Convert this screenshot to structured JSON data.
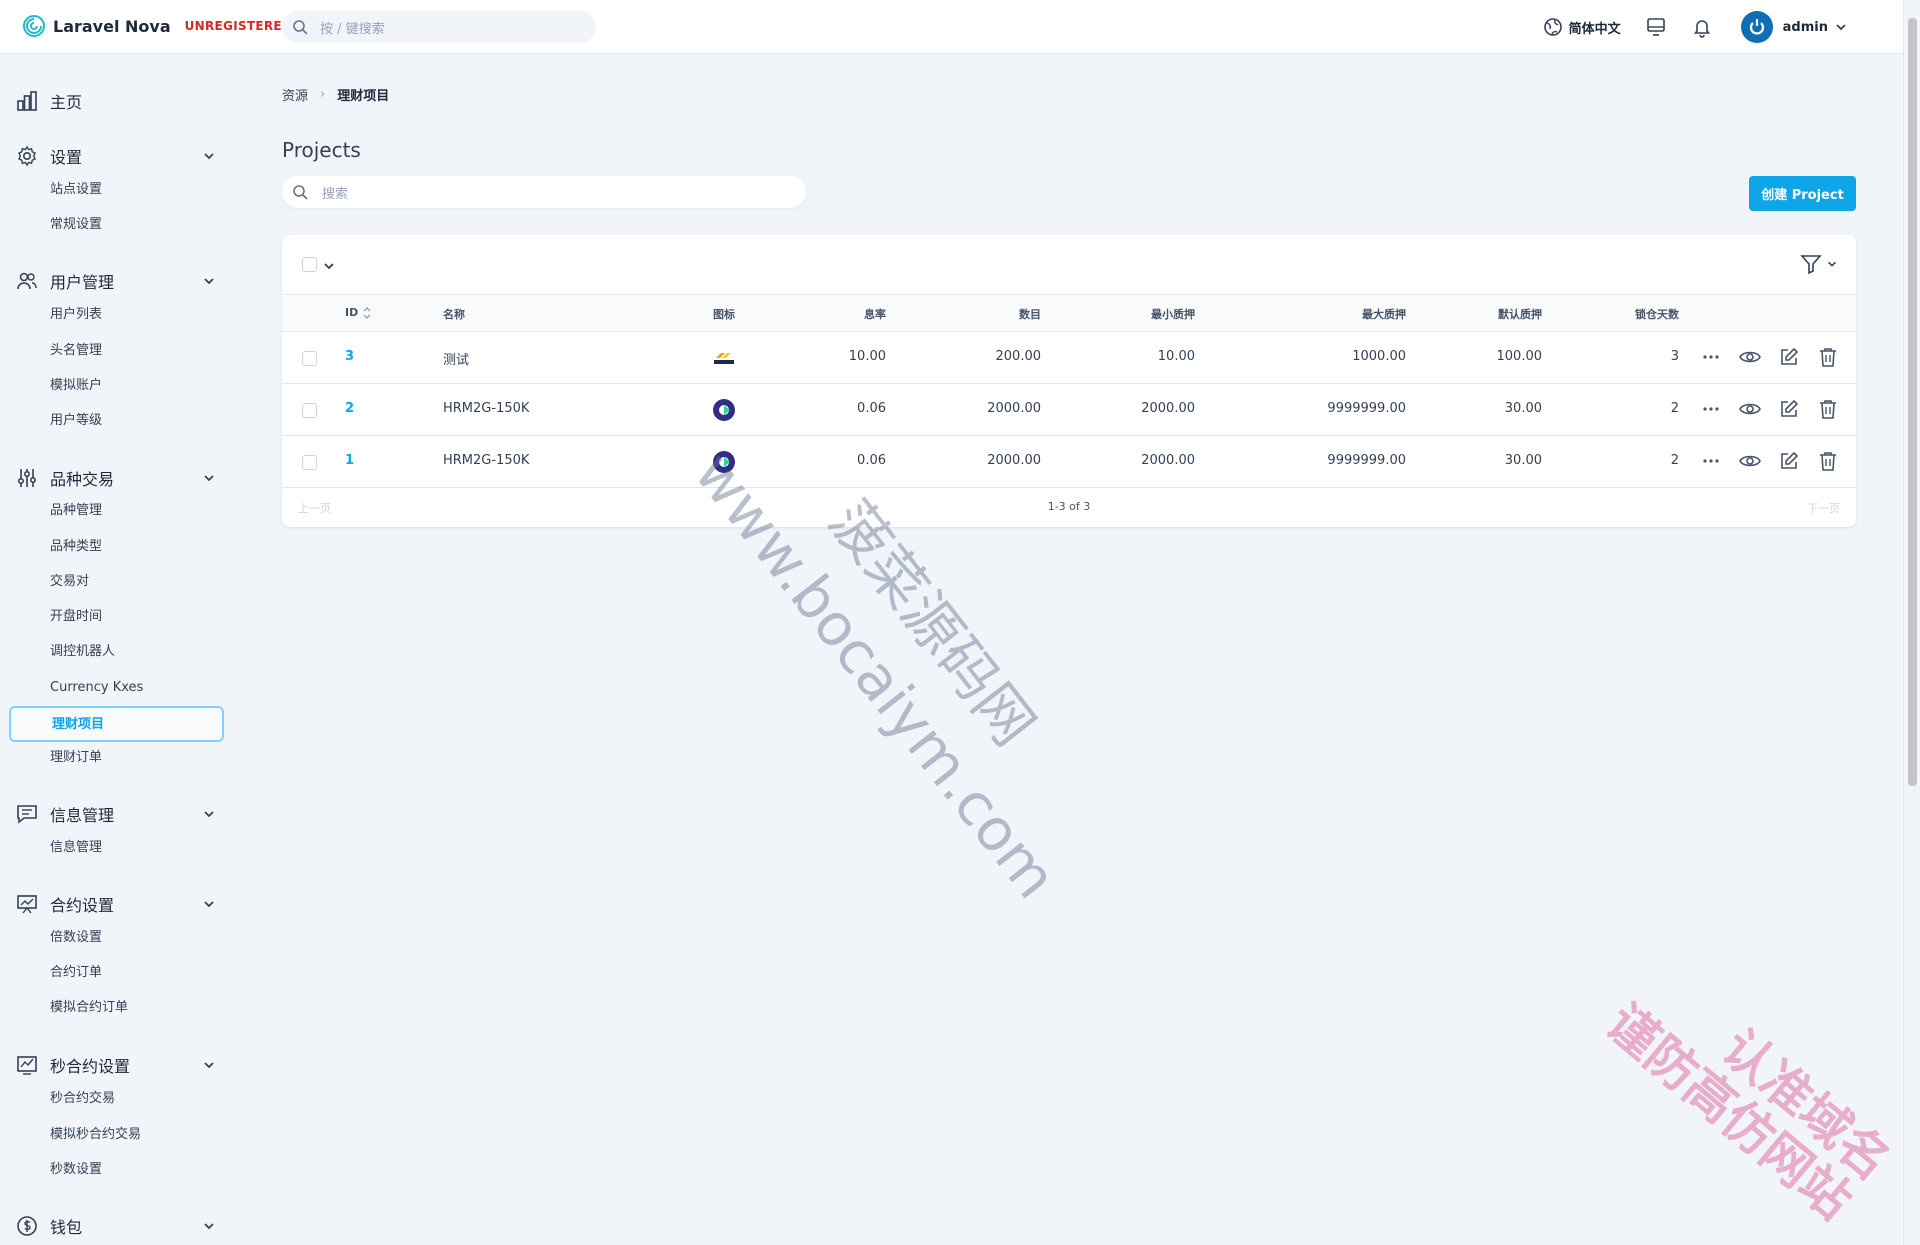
{
  "header": {
    "app_name": "Laravel Nova",
    "badge": "UNREGISTERED",
    "search_placeholder": "按 / 键搜索",
    "language": "简体中文",
    "user_name": "admin"
  },
  "sidebar": {
    "home": "主页",
    "groups": [
      {
        "label": "设置",
        "items": [
          "站点设置",
          "常规设置"
        ]
      },
      {
        "label": "用户管理",
        "items": [
          "用户列表",
          "头名管理",
          "模拟账户",
          "用户等级"
        ]
      },
      {
        "label": "品种交易",
        "items": [
          "品种管理",
          "品种类型",
          "交易对",
          "开盘时间",
          "调控机器人",
          "Currency Kxes",
          "理财项目",
          "理财订单"
        ]
      },
      {
        "label": "信息管理",
        "items": [
          "信息管理"
        ]
      },
      {
        "label": "合约设置",
        "items": [
          "倍数设置",
          "合约订单",
          "模拟合约订单"
        ]
      },
      {
        "label": "秒合约设置",
        "items": [
          "秒合约交易",
          "模拟秒合约交易",
          "秒数设置"
        ]
      },
      {
        "label": "钱包",
        "items": []
      }
    ],
    "active_item": "理财项目"
  },
  "breadcrumb": [
    "资源",
    "理财项目"
  ],
  "page_title": "Projects",
  "resource_search_placeholder": "搜索",
  "create_button": "创建 Project",
  "table": {
    "columns": [
      "ID",
      "名称",
      "图标",
      "息率",
      "数目",
      "最小质押",
      "最大质押",
      "默认质押",
      "锁仓天数"
    ],
    "rows": [
      {
        "id": "3",
        "name": "测试",
        "icon": "express-logo-icon",
        "rate": "10.00",
        "amount": "200.00",
        "min": "10.00",
        "max": "1000.00",
        "default": "100.00",
        "days": "3"
      },
      {
        "id": "2",
        "name": "HRM2G-150K",
        "icon": "c-coin-icon",
        "rate": "0.06",
        "amount": "2000.00",
        "min": "2000.00",
        "max": "9999999.00",
        "default": "30.00",
        "days": "2"
      },
      {
        "id": "1",
        "name": "HRM2G-150K",
        "icon": "c-coin-icon",
        "rate": "0.06",
        "amount": "2000.00",
        "min": "2000.00",
        "max": "9999999.00",
        "default": "30.00",
        "days": "2"
      }
    ]
  },
  "pager": {
    "prev": "上一页",
    "info": "1-3 of 3",
    "next": "下一页"
  },
  "watermarks": [
    "www.bocaiym.com",
    "菠菜源码网",
    "认准域名",
    "谨防高仿网站"
  ],
  "colors": {
    "accent": "#0ea5e9",
    "badge": "#dc2626",
    "avatar": "#0f6fb5"
  }
}
